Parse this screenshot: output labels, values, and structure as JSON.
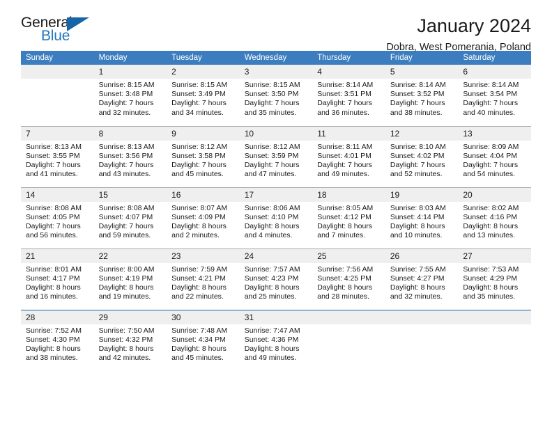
{
  "logo": {
    "word_one": "General",
    "word_two": "Blue",
    "triangle_color": "#1565a8",
    "blue_text_color": "#2179bf"
  },
  "header": {
    "title": "January 2024",
    "subtitle": "Dobra, West Pomerania, Poland"
  },
  "theme": {
    "header_bg": "#3b7dbf",
    "daynum_bg": "#efefef",
    "separator_gray": "#a9a9a9",
    "separator_blue": "#1565a8"
  },
  "calendar": {
    "weekdays": [
      "Sunday",
      "Monday",
      "Tuesday",
      "Wednesday",
      "Thursday",
      "Friday",
      "Saturday"
    ],
    "weeks": [
      [
        {
          "day": "",
          "sunrise": "",
          "sunset": "",
          "daylight_line1": "",
          "daylight_line2": ""
        },
        {
          "day": "1",
          "sunrise": "Sunrise: 8:15 AM",
          "sunset": "Sunset: 3:48 PM",
          "daylight_line1": "Daylight: 7 hours",
          "daylight_line2": "and 32 minutes."
        },
        {
          "day": "2",
          "sunrise": "Sunrise: 8:15 AM",
          "sunset": "Sunset: 3:49 PM",
          "daylight_line1": "Daylight: 7 hours",
          "daylight_line2": "and 34 minutes."
        },
        {
          "day": "3",
          "sunrise": "Sunrise: 8:15 AM",
          "sunset": "Sunset: 3:50 PM",
          "daylight_line1": "Daylight: 7 hours",
          "daylight_line2": "and 35 minutes."
        },
        {
          "day": "4",
          "sunrise": "Sunrise: 8:14 AM",
          "sunset": "Sunset: 3:51 PM",
          "daylight_line1": "Daylight: 7 hours",
          "daylight_line2": "and 36 minutes."
        },
        {
          "day": "5",
          "sunrise": "Sunrise: 8:14 AM",
          "sunset": "Sunset: 3:52 PM",
          "daylight_line1": "Daylight: 7 hours",
          "daylight_line2": "and 38 minutes."
        },
        {
          "day": "6",
          "sunrise": "Sunrise: 8:14 AM",
          "sunset": "Sunset: 3:54 PM",
          "daylight_line1": "Daylight: 7 hours",
          "daylight_line2": "and 40 minutes."
        }
      ],
      [
        {
          "day": "7",
          "sunrise": "Sunrise: 8:13 AM",
          "sunset": "Sunset: 3:55 PM",
          "daylight_line1": "Daylight: 7 hours",
          "daylight_line2": "and 41 minutes."
        },
        {
          "day": "8",
          "sunrise": "Sunrise: 8:13 AM",
          "sunset": "Sunset: 3:56 PM",
          "daylight_line1": "Daylight: 7 hours",
          "daylight_line2": "and 43 minutes."
        },
        {
          "day": "9",
          "sunrise": "Sunrise: 8:12 AM",
          "sunset": "Sunset: 3:58 PM",
          "daylight_line1": "Daylight: 7 hours",
          "daylight_line2": "and 45 minutes."
        },
        {
          "day": "10",
          "sunrise": "Sunrise: 8:12 AM",
          "sunset": "Sunset: 3:59 PM",
          "daylight_line1": "Daylight: 7 hours",
          "daylight_line2": "and 47 minutes."
        },
        {
          "day": "11",
          "sunrise": "Sunrise: 8:11 AM",
          "sunset": "Sunset: 4:01 PM",
          "daylight_line1": "Daylight: 7 hours",
          "daylight_line2": "and 49 minutes."
        },
        {
          "day": "12",
          "sunrise": "Sunrise: 8:10 AM",
          "sunset": "Sunset: 4:02 PM",
          "daylight_line1": "Daylight: 7 hours",
          "daylight_line2": "and 52 minutes."
        },
        {
          "day": "13",
          "sunrise": "Sunrise: 8:09 AM",
          "sunset": "Sunset: 4:04 PM",
          "daylight_line1": "Daylight: 7 hours",
          "daylight_line2": "and 54 minutes."
        }
      ],
      [
        {
          "day": "14",
          "sunrise": "Sunrise: 8:08 AM",
          "sunset": "Sunset: 4:05 PM",
          "daylight_line1": "Daylight: 7 hours",
          "daylight_line2": "and 56 minutes."
        },
        {
          "day": "15",
          "sunrise": "Sunrise: 8:08 AM",
          "sunset": "Sunset: 4:07 PM",
          "daylight_line1": "Daylight: 7 hours",
          "daylight_line2": "and 59 minutes."
        },
        {
          "day": "16",
          "sunrise": "Sunrise: 8:07 AM",
          "sunset": "Sunset: 4:09 PM",
          "daylight_line1": "Daylight: 8 hours",
          "daylight_line2": "and 2 minutes."
        },
        {
          "day": "17",
          "sunrise": "Sunrise: 8:06 AM",
          "sunset": "Sunset: 4:10 PM",
          "daylight_line1": "Daylight: 8 hours",
          "daylight_line2": "and 4 minutes."
        },
        {
          "day": "18",
          "sunrise": "Sunrise: 8:05 AM",
          "sunset": "Sunset: 4:12 PM",
          "daylight_line1": "Daylight: 8 hours",
          "daylight_line2": "and 7 minutes."
        },
        {
          "day": "19",
          "sunrise": "Sunrise: 8:03 AM",
          "sunset": "Sunset: 4:14 PM",
          "daylight_line1": "Daylight: 8 hours",
          "daylight_line2": "and 10 minutes."
        },
        {
          "day": "20",
          "sunrise": "Sunrise: 8:02 AM",
          "sunset": "Sunset: 4:16 PM",
          "daylight_line1": "Daylight: 8 hours",
          "daylight_line2": "and 13 minutes."
        }
      ],
      [
        {
          "day": "21",
          "sunrise": "Sunrise: 8:01 AM",
          "sunset": "Sunset: 4:17 PM",
          "daylight_line1": "Daylight: 8 hours",
          "daylight_line2": "and 16 minutes."
        },
        {
          "day": "22",
          "sunrise": "Sunrise: 8:00 AM",
          "sunset": "Sunset: 4:19 PM",
          "daylight_line1": "Daylight: 8 hours",
          "daylight_line2": "and 19 minutes."
        },
        {
          "day": "23",
          "sunrise": "Sunrise: 7:59 AM",
          "sunset": "Sunset: 4:21 PM",
          "daylight_line1": "Daylight: 8 hours",
          "daylight_line2": "and 22 minutes."
        },
        {
          "day": "24",
          "sunrise": "Sunrise: 7:57 AM",
          "sunset": "Sunset: 4:23 PM",
          "daylight_line1": "Daylight: 8 hours",
          "daylight_line2": "and 25 minutes."
        },
        {
          "day": "25",
          "sunrise": "Sunrise: 7:56 AM",
          "sunset": "Sunset: 4:25 PM",
          "daylight_line1": "Daylight: 8 hours",
          "daylight_line2": "and 28 minutes."
        },
        {
          "day": "26",
          "sunrise": "Sunrise: 7:55 AM",
          "sunset": "Sunset: 4:27 PM",
          "daylight_line1": "Daylight: 8 hours",
          "daylight_line2": "and 32 minutes."
        },
        {
          "day": "27",
          "sunrise": "Sunrise: 7:53 AM",
          "sunset": "Sunset: 4:29 PM",
          "daylight_line1": "Daylight: 8 hours",
          "daylight_line2": "and 35 minutes."
        }
      ],
      [
        {
          "day": "28",
          "sunrise": "Sunrise: 7:52 AM",
          "sunset": "Sunset: 4:30 PM",
          "daylight_line1": "Daylight: 8 hours",
          "daylight_line2": "and 38 minutes."
        },
        {
          "day": "29",
          "sunrise": "Sunrise: 7:50 AM",
          "sunset": "Sunset: 4:32 PM",
          "daylight_line1": "Daylight: 8 hours",
          "daylight_line2": "and 42 minutes."
        },
        {
          "day": "30",
          "sunrise": "Sunrise: 7:48 AM",
          "sunset": "Sunset: 4:34 PM",
          "daylight_line1": "Daylight: 8 hours",
          "daylight_line2": "and 45 minutes."
        },
        {
          "day": "31",
          "sunrise": "Sunrise: 7:47 AM",
          "sunset": "Sunset: 4:36 PM",
          "daylight_line1": "Daylight: 8 hours",
          "daylight_line2": "and 49 minutes."
        },
        {
          "day": "",
          "sunrise": "",
          "sunset": "",
          "daylight_line1": "",
          "daylight_line2": ""
        },
        {
          "day": "",
          "sunrise": "",
          "sunset": "",
          "daylight_line1": "",
          "daylight_line2": ""
        },
        {
          "day": "",
          "sunrise": "",
          "sunset": "",
          "daylight_line1": "",
          "daylight_line2": ""
        }
      ]
    ]
  }
}
